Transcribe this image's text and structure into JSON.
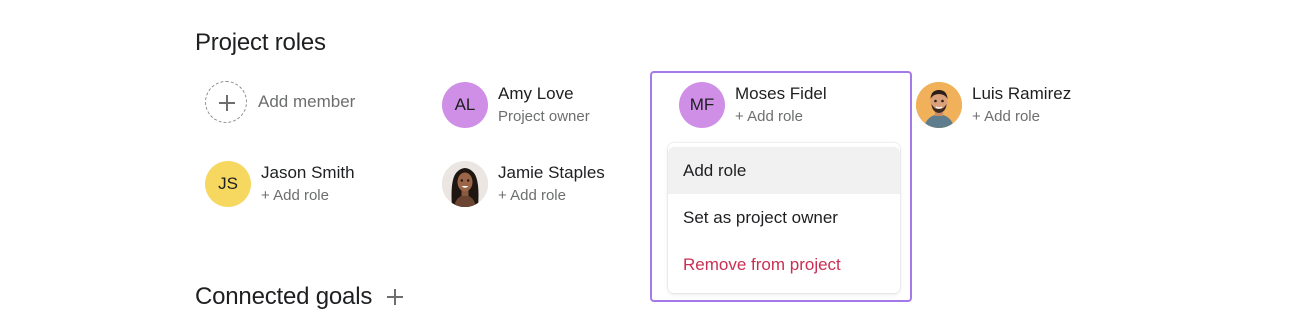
{
  "roles_section": {
    "title": "Project roles"
  },
  "add_member": {
    "label": "Add member"
  },
  "members": {
    "amy": {
      "initials": "AL",
      "name": "Amy Love",
      "role": "Project owner",
      "avatar_color": "#cf8fe6"
    },
    "moses": {
      "initials": "MF",
      "name": "Moses Fidel",
      "role": "+ Add role",
      "avatar_color": "#cf8fe6"
    },
    "luis": {
      "name": "Luis Ramirez",
      "role": "+ Add role",
      "avatar_color": "#f0b15a"
    },
    "jason": {
      "initials": "JS",
      "name": "Jason Smith",
      "role": "+ Add role",
      "avatar_color": "#f6d860"
    },
    "jamie": {
      "name": "Jamie Staples",
      "role": "+ Add role"
    }
  },
  "dropdown": {
    "items": [
      {
        "label": "Add role"
      },
      {
        "label": "Set as project owner"
      },
      {
        "label": "Remove from project"
      }
    ]
  },
  "goals_section": {
    "title": "Connected goals"
  },
  "colors": {
    "accent_border": "#a479e8",
    "danger": "#c92f54",
    "muted": "#6d6e6f"
  },
  "icons": {
    "add_member": "plus-icon",
    "add_goal": "plus-icon"
  }
}
